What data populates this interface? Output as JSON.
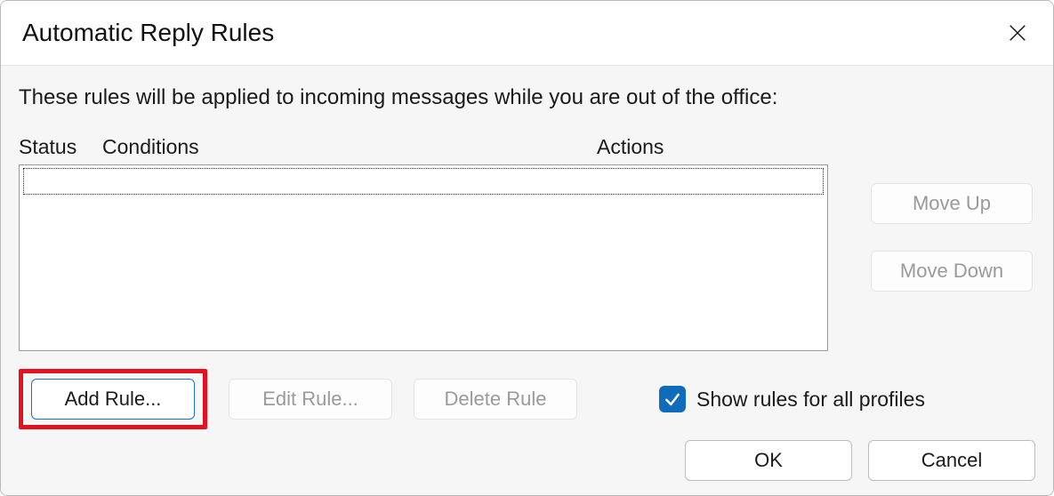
{
  "window": {
    "title": "Automatic Reply Rules"
  },
  "intro": "These rules will be applied to incoming messages while you are out of the office:",
  "columns": {
    "status": "Status",
    "conditions": "Conditions",
    "actions": "Actions"
  },
  "rules": [],
  "buttons": {
    "move_up": "Move Up",
    "move_down": "Move Down",
    "add_rule": "Add Rule...",
    "edit_rule": "Edit Rule...",
    "delete_rule": "Delete Rule",
    "ok": "OK",
    "cancel": "Cancel"
  },
  "button_state": {
    "move_up_enabled": false,
    "move_down_enabled": false,
    "add_rule_enabled": true,
    "edit_rule_enabled": false,
    "delete_rule_enabled": false
  },
  "checkbox": {
    "show_all_label": "Show rules for all profiles",
    "show_all_checked": true
  },
  "icons": {
    "close": "close-icon",
    "checkmark": "checkmark-icon"
  },
  "highlight": {
    "target": "add_rule",
    "color": "#e51121"
  }
}
